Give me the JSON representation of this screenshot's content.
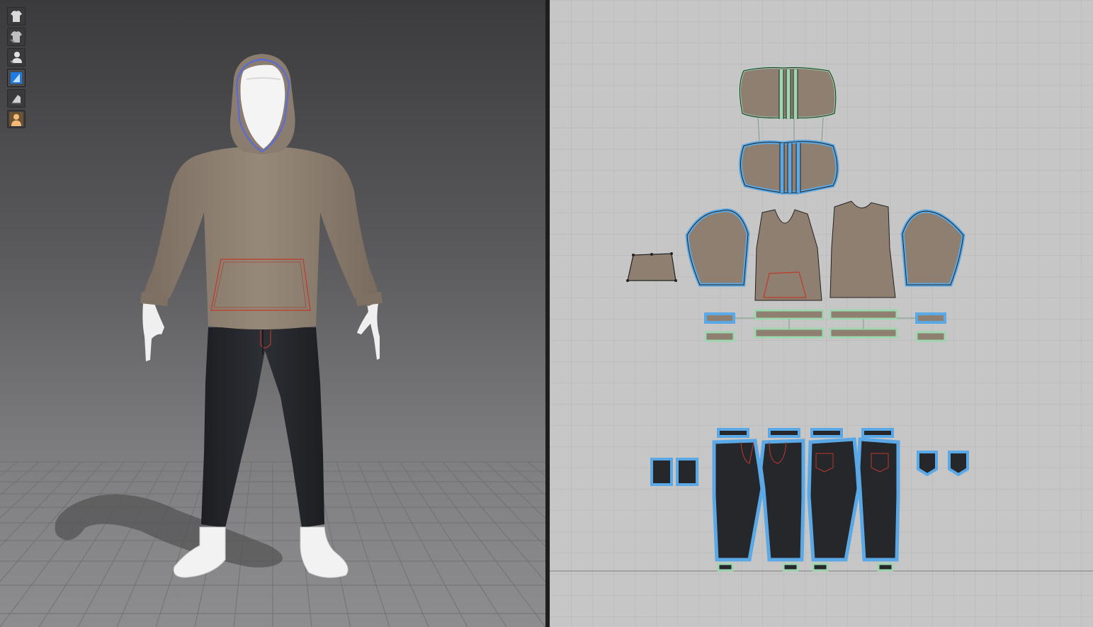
{
  "app": {
    "panels": [
      "3d-avatar-view",
      "2d-pattern-view"
    ]
  },
  "toolbar": {
    "buttons": [
      {
        "icon": "garment-shirt-icon",
        "state": "normal"
      },
      {
        "icon": "garment-shirt-alt-icon",
        "state": "normal"
      },
      {
        "icon": "avatar-select-icon",
        "state": "normal"
      },
      {
        "icon": "fold-tool-icon",
        "state": "selected"
      },
      {
        "icon": "texture-surface-icon",
        "state": "normal"
      },
      {
        "icon": "avatar-show-icon",
        "state": "normal"
      }
    ]
  },
  "scene": {
    "garments": [
      "hoodie",
      "jeans"
    ],
    "colors": {
      "hoodie": "#8e7f70",
      "jeans": "#25272b",
      "avatar": "#e8e8e8",
      "outline_selected": "#5a6bd8",
      "pocket_stitch": "#c0392b",
      "pattern_highlight": "#5aa9e6",
      "pattern_seam": "#9fd6b0",
      "canvas_2d": "#c6c6c6"
    }
  }
}
